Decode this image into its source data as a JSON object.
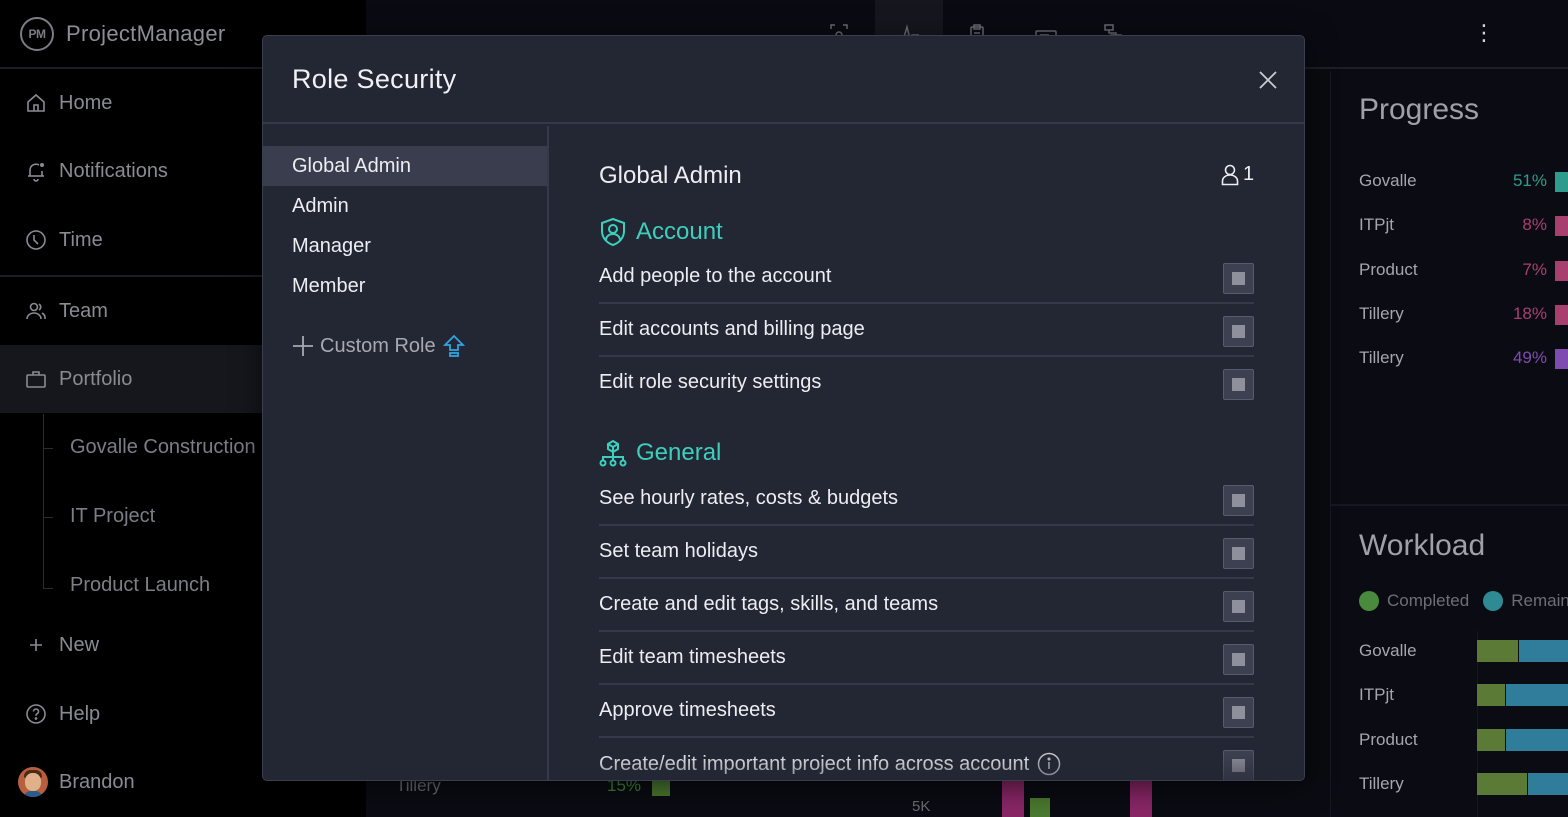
{
  "app": {
    "brand_logo": "PM",
    "brand_name": "ProjectManager"
  },
  "sidebar": {
    "items": [
      {
        "label": "Home",
        "icon": "home-icon"
      },
      {
        "label": "Notifications",
        "icon": "bell-icon"
      },
      {
        "label": "Time",
        "icon": "clock-icon"
      },
      {
        "label": "Team",
        "icon": "team-icon"
      },
      {
        "label": "Portfolio",
        "icon": "briefcase-icon",
        "active": true
      },
      {
        "label": "New",
        "icon": "plus-icon"
      },
      {
        "label": "Help",
        "icon": "help-icon"
      },
      {
        "label": "Brandon",
        "icon": "avatar"
      }
    ],
    "portfolio_projects": [
      "Govalle Construction",
      "IT Project",
      "Product Launch"
    ]
  },
  "topbar": {
    "icons": [
      "screenshot-icon",
      "activity-icon",
      "clipboard-icon",
      "card-icon",
      "hierarchy-icon"
    ],
    "more_icon": "kebab-icon"
  },
  "background": {
    "progress": {
      "title": "Progress",
      "rows": [
        {
          "name": "Govalle",
          "pct": "51%",
          "color": "#2e9c8c"
        },
        {
          "name": "ITPjt",
          "pct": "8%",
          "color": "#a8406f"
        },
        {
          "name": "Product",
          "pct": "7%",
          "color": "#a8406f"
        },
        {
          "name": "Tillery",
          "pct": "18%",
          "color": "#a8406f"
        },
        {
          "name": "Tillery",
          "pct": "49%",
          "color": "#7e4cb0"
        }
      ]
    },
    "workload": {
      "title": "Workload",
      "legend": [
        {
          "label": "Completed",
          "color": "#4a8a3c"
        },
        {
          "label": "Remaining",
          "color": "#2f8a93"
        }
      ],
      "rows": [
        {
          "name": "Govalle",
          "completed_fraction": 0.3
        },
        {
          "name": "ITPjt",
          "completed_fraction": 0.2
        },
        {
          "name": "Product",
          "completed_fraction": 0.2
        },
        {
          "name": "Tillery",
          "completed_fraction": 0.4
        }
      ]
    },
    "bottom_row": {
      "name": "Tillery",
      "pct": "15%",
      "axis_label": "5K"
    }
  },
  "modal": {
    "title": "Role Security",
    "roles": [
      "Global Admin",
      "Admin",
      "Manager",
      "Member"
    ],
    "selected_role": "Global Admin",
    "custom_role_label": "Custom Role",
    "content": {
      "role_title": "Global Admin",
      "user_count": "1",
      "sections": [
        {
          "title": "Account",
          "icon": "shield-user-icon",
          "permissions": [
            {
              "label": "Add people to the account",
              "checked": true
            },
            {
              "label": "Edit accounts and billing page",
              "checked": true
            },
            {
              "label": "Edit role security settings",
              "checked": true
            }
          ]
        },
        {
          "title": "General",
          "icon": "hierarchy-icon",
          "permissions": [
            {
              "label": "See hourly rates, costs & budgets",
              "checked": true
            },
            {
              "label": "Set team holidays",
              "checked": true
            },
            {
              "label": "Create and edit tags, skills, and teams",
              "checked": true
            },
            {
              "label": "Edit team timesheets",
              "checked": true
            },
            {
              "label": "Approve timesheets",
              "checked": true
            },
            {
              "label": "Create/edit important project info across account",
              "checked": true,
              "info": true
            }
          ]
        }
      ]
    }
  }
}
